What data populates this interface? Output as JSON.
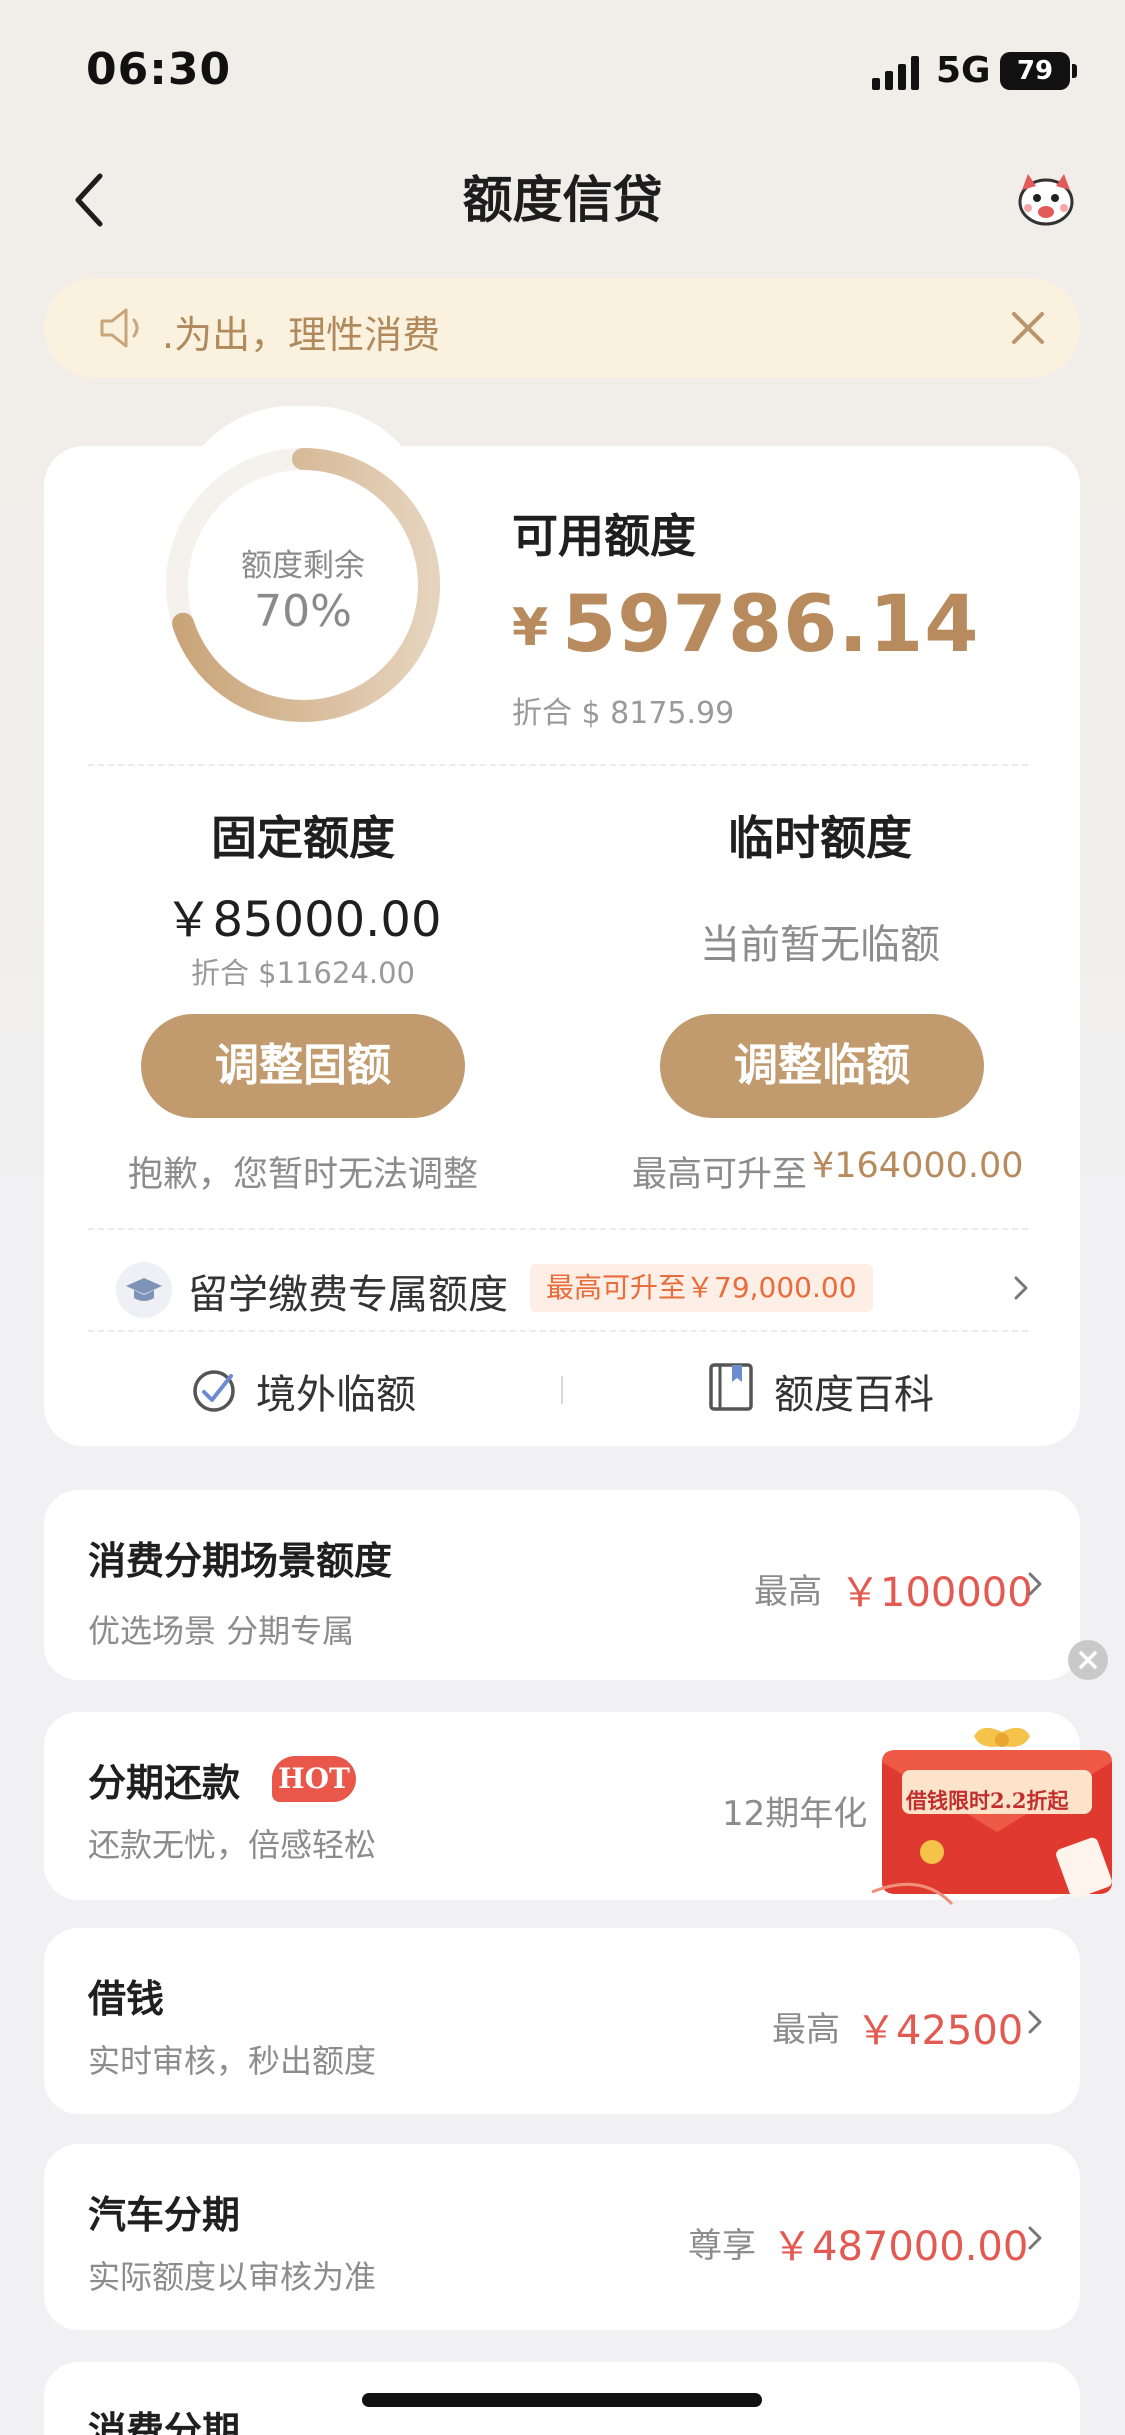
{
  "status_bar": {
    "time": "06:30",
    "network": "5G",
    "battery": "79"
  },
  "nav": {
    "title": "额度信贷"
  },
  "notice": {
    "text": ".为出，理性消费"
  },
  "credit": {
    "ring_label": "额度剩余",
    "ring_percent": "70%",
    "ring_fraction": 0.7,
    "available_title": "可用额度",
    "available_currency": "¥",
    "available_amount": "59786.14",
    "available_converted": "折合 $ 8175.99",
    "fixed": {
      "title": "固定额度",
      "amount": "￥85000.00",
      "converted": "折合 $11624.00",
      "button": "调整固额",
      "note": "抱歉，您暂时无法调整"
    },
    "temporary": {
      "title": "临时额度",
      "status": "当前暂无临额",
      "button": "调整临额",
      "max_label": "最高可升至",
      "max_value": "¥164000.00"
    },
    "study": {
      "label": "留学缴费专属额度",
      "badge": "最高可升至￥79,000.00"
    },
    "links": [
      {
        "label": "境外临额"
      },
      {
        "label": "额度百科"
      }
    ]
  },
  "products": [
    {
      "title": "消费分期场景额度",
      "subtitle": "优选场景 分期专属",
      "prefix": "最高",
      "value": "￥100000"
    },
    {
      "title": "分期还款",
      "badge": "HOT",
      "subtitle": "还款无忧，倍感轻松",
      "prefix": "12期年化",
      "value": ""
    },
    {
      "title": "借钱",
      "subtitle": "实时审核，秒出额度",
      "prefix": "最高",
      "value": "￥42500"
    },
    {
      "title": "汽车分期",
      "subtitle": "实际额度以审核为准",
      "prefix": "尊享",
      "value": "￥487000.00"
    },
    {
      "title": "消费分期"
    }
  ],
  "promo": {
    "text": "借钱限时2.2折起"
  },
  "colors": {
    "accent": "#c19b6e",
    "gold_text": "#b78b5d",
    "red_value": "#e35a52",
    "hot": "#e8574a"
  }
}
